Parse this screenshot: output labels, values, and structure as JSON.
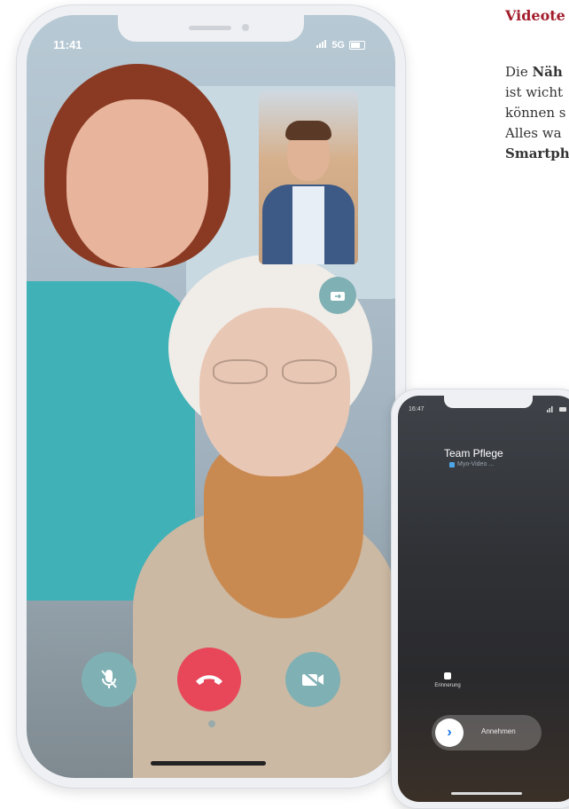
{
  "aside": {
    "headline": "Videote",
    "para_line1_prefix": "Die ",
    "para_line1_bold": "Näh",
    "para_line2": "ist wicht",
    "para_line3": "können s",
    "para_line4": "Alles wa",
    "para_line5_bold": "Smartph"
  },
  "video_call": {
    "status_time": "11:41",
    "status_network": "5G",
    "controls": {
      "mute_icon": "mic-off-icon",
      "hangup_icon": "phone-hangup-icon",
      "video_off_icon": "video-off-icon",
      "swap_camera_icon": "switch-camera-icon"
    },
    "colors": {
      "control_teal": "#7fb0b4",
      "hangup_red": "#e8475a"
    }
  },
  "incoming_call": {
    "status_time": "16:47",
    "caller_name": "Team Pflege",
    "caller_subtitle": "Myo-Video ...",
    "reminder_label": "Erinnerung",
    "slider_label": "Annehmen",
    "slider_icon": "chevron-right-icon"
  }
}
